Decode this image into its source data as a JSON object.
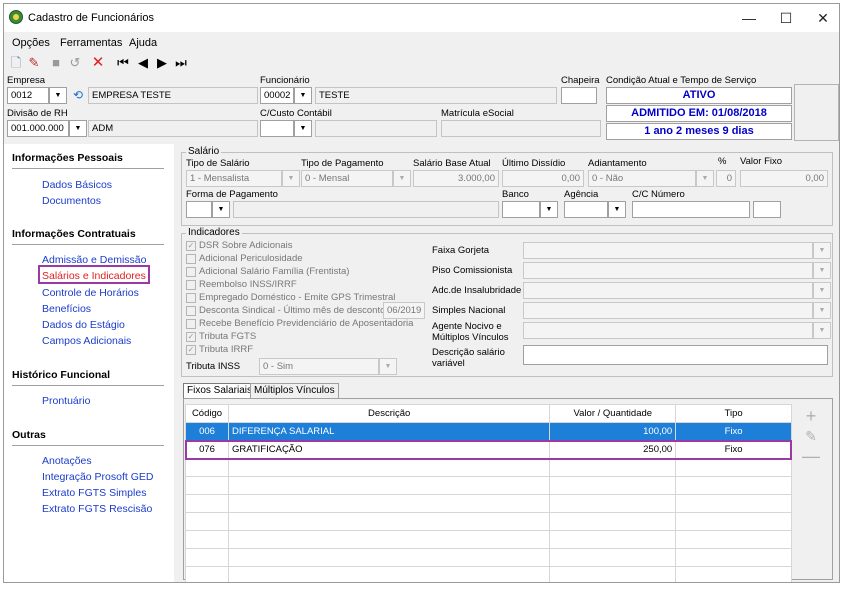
{
  "window": {
    "title": "Cadastro de Funcionários",
    "min": "—",
    "max": "☐",
    "close": "✕"
  },
  "menu": [
    "Opções",
    "Ferramentas",
    "Ajuda"
  ],
  "toolbar": {
    "icons": [
      "new-icon",
      "edit-icon",
      "save-icon",
      "undo-icon",
      "delete-icon",
      "first-icon",
      "prev-icon",
      "next-icon",
      "last-icon"
    ]
  },
  "header": {
    "empresa_label": "Empresa",
    "empresa_code": "0012",
    "empresa_name": "EMPRESA TESTE",
    "funcionario_label": "Funcionário",
    "funcionario_code": "00002",
    "funcionario_name": "TESTE",
    "chapeira_label": "Chapeira",
    "chapeira_value": "",
    "condicao_label": "Condição Atual e Tempo de Serviço",
    "status": "ATIVO",
    "admitido": "ADMITIDO EM: 01/08/2018",
    "tempo": "1 ano 2 meses 9 dias",
    "divisao_label": "Divisão de RH",
    "divisao_code": "001.000.000",
    "divisao_name": "ADM",
    "custo_label": "C/Custo Contábil",
    "custo_code": "",
    "custo_name": "",
    "matricula_label": "Matrícula eSocial",
    "matricula_value": ""
  },
  "sidebar": {
    "sections": [
      {
        "title": "Informações Pessoais",
        "items": [
          "Dados Básicos",
          "Documentos"
        ]
      },
      {
        "title": "Informações Contratuais",
        "items": [
          "Admissão e Demissão",
          "Salários e Indicadores",
          "Controle de Horários",
          "Benefícios",
          "Dados do Estágio",
          "Campos Adicionais"
        ]
      },
      {
        "title": "Histórico Funcional",
        "items": [
          "Prontuário"
        ]
      },
      {
        "title": "Outras",
        "items": [
          "Anotações",
          "Integração Prosoft GED",
          "Extrato FGTS Simples",
          "Extrato FGTS Rescisão"
        ]
      }
    ]
  },
  "salario": {
    "group_title": "Salário",
    "tipo_label": "Tipo de Salário",
    "tipo_value": "1 - Mensalista",
    "pagamento_label": "Tipo de Pagamento",
    "pagamento_value": "0 - Mensal",
    "base_label": "Salário Base Atual",
    "base_value": "3.000,00",
    "dissidio_label": "Último Dissídio",
    "dissidio_value": "0,00",
    "adiantamento_label": "Adiantamento",
    "adiantamento_value": "0 - Não",
    "perc_label": "%",
    "perc_value": "0",
    "fixo_label": "Valor Fixo",
    "fixo_value": "0,00",
    "forma_label": "Forma de Pagamento",
    "forma_value": "",
    "banco_label": "Banco",
    "agencia_label": "Agência",
    "cc_label": "C/C Número"
  },
  "indicadores": {
    "group_title": "Indicadores",
    "checks": [
      {
        "label": "DSR Sobre Adicionais",
        "checked": true
      },
      {
        "label": "Adicional Periculosidade",
        "checked": false
      },
      {
        "label": "Adicional Salário Família (Frentista)",
        "checked": false
      },
      {
        "label": "Reembolso INSS/IRRF",
        "checked": false
      },
      {
        "label": "Empregado Doméstico - Emite GPS Trimestral",
        "checked": false
      },
      {
        "label": "Desconta Sindical - Último mês de desconto",
        "checked": false
      },
      {
        "label": "Recebe Benefício Previdenciário de Aposentadoria",
        "checked": false
      },
      {
        "label": "Tributa FGTS",
        "checked": true
      },
      {
        "label": "Tributa IRRF",
        "checked": true
      }
    ],
    "sindical_date": "06/2019",
    "inss_label": "Tributa INSS",
    "inss_value": "0 - Sim",
    "right_labels": [
      "Faixa Gorjeta",
      "Piso Comissionista",
      "Adc.de Insalubridade",
      "Simples Nacional",
      "Agente Nocivo e Múltiplos Vínculos",
      "Descrição salário variável"
    ]
  },
  "tabs": [
    "Fixos Salariais",
    "Múltiplos Vínculos"
  ],
  "grid": {
    "headers": [
      "Código",
      "Descrição",
      "Valor / Quantidade",
      "Tipo"
    ],
    "rows": [
      {
        "codigo": "006",
        "descricao": "DIFERENÇA SALARIAL",
        "valor": "100,00",
        "tipo": "Fixo"
      },
      {
        "codigo": "076",
        "descricao": "GRATIFICAÇÃO",
        "valor": "250,00",
        "tipo": "Fixo"
      }
    ],
    "side_buttons": [
      "plus-icon",
      "edit-icon",
      "minus-icon"
    ]
  }
}
